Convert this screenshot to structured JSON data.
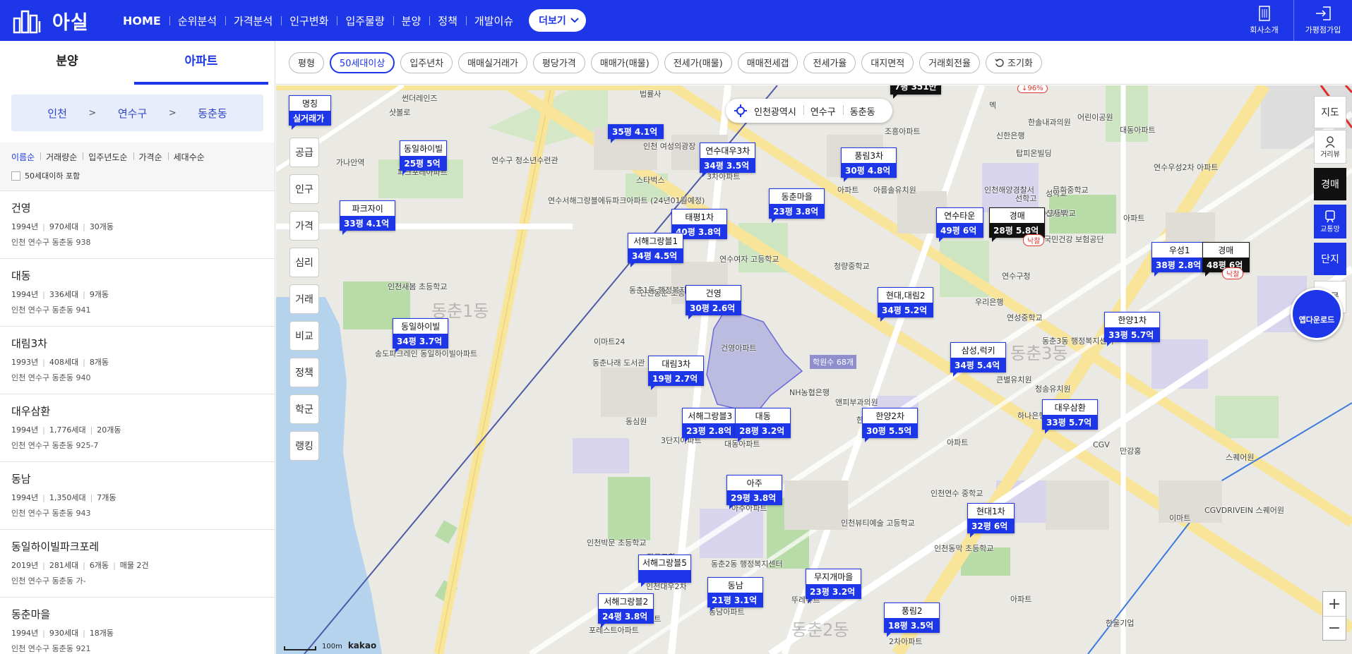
{
  "header": {
    "logo_text": "아실",
    "nav": [
      "HOME",
      "순위분석",
      "가격분석",
      "인구변화",
      "입주물량",
      "분양",
      "정책",
      "개발이슈"
    ],
    "more_label": "더보기",
    "right": [
      {
        "label": "회사소개",
        "icon": "building-icon"
      },
      {
        "label": "가평점가입",
        "icon": "login-icon"
      }
    ]
  },
  "sidebar": {
    "tabs": [
      "분양",
      "아파트"
    ],
    "active_tab": "아파트",
    "breadcrumb": [
      "인천",
      "연수구",
      "동춘동"
    ],
    "sort_options": [
      "이름순",
      "거래량순",
      "입주년도순",
      "가격순",
      "세대수순"
    ],
    "checkbox_label": "50세대이하 포함",
    "items": [
      {
        "name": "건영",
        "year": "1994년",
        "households": "970세대",
        "buildings": "30개동",
        "extra": "",
        "address": "인천 연수구 동춘동 938"
      },
      {
        "name": "대동",
        "year": "1994년",
        "households": "336세대",
        "buildings": "9개동",
        "extra": "",
        "address": "인천 연수구 동춘동 941"
      },
      {
        "name": "대림3차",
        "year": "1993년",
        "households": "408세대",
        "buildings": "8개동",
        "extra": "",
        "address": "인천 연수구 동춘동 940"
      },
      {
        "name": "대우삼환",
        "year": "1994년",
        "households": "1,776세대",
        "buildings": "20개동",
        "extra": "",
        "address": "인천 연수구 동춘동 925-7"
      },
      {
        "name": "동남",
        "year": "1994년",
        "households": "1,350세대",
        "buildings": "7개동",
        "extra": "",
        "address": "인천 연수구 동춘동 943"
      },
      {
        "name": "동일하이빌파크포레",
        "year": "2019년",
        "households": "281세대",
        "buildings": "6개동",
        "extra": "매물 2건",
        "address": "인천 연수구 동춘동 가-"
      },
      {
        "name": "동춘마을",
        "year": "1994년",
        "households": "930세대",
        "buildings": "18개동",
        "extra": "",
        "address": "인천 연수구 동춘동 921"
      }
    ]
  },
  "filters": {
    "chips": [
      "평형",
      "50세대이상",
      "입주년차",
      "매매실거래가",
      "평당가격",
      "매매가(매물)",
      "전세가(매물)",
      "매매전세갭",
      "전세가율",
      "대지면적",
      "거래회전율"
    ],
    "active": "50세대이상",
    "reset_label": "조기화"
  },
  "map": {
    "location_pill": [
      "인천광역시",
      "연수구",
      "동춘동"
    ],
    "left_buttons": [
      "공급",
      "인구",
      "가격",
      "심리",
      "거래",
      "비교",
      "정책",
      "학군",
      "랭킹"
    ],
    "right_buttons": [
      "지도",
      "거리뷰",
      "경매",
      "교통망",
      "단지",
      "매물"
    ],
    "app_download": "앱다운로드",
    "scale": "100m",
    "provider": "kakao",
    "hakwon_label": "학원수 68개",
    "nakchal_label": "낙찰",
    "top_marker_value": "7평 351만",
    "top_marker_change": "↓96%",
    "markers": [
      {
        "name": "명칭",
        "value": "실거래가"
      },
      {
        "name": "동일하이빌",
        "value": "25평 5억"
      },
      {
        "name": "파크자이",
        "value": "33평 4.1억"
      },
      {
        "name": "동일하이빌",
        "value": "34평 3.7억"
      },
      {
        "name": "",
        "value": "35평 4.1억"
      },
      {
        "name": "연수대우3차",
        "value": "34평 3.5억"
      },
      {
        "name": "풍림3차",
        "value": "30평 4.8억"
      },
      {
        "name": "동춘마을",
        "value": "23평 3.8억"
      },
      {
        "name": "태평1차",
        "value": "40평 3.8억"
      },
      {
        "name": "서해그랑블1",
        "value": "34평 4.5억"
      },
      {
        "name": "연수타운",
        "value": "49평 6억"
      },
      {
        "name": "경매",
        "value": "28평 5.8억"
      },
      {
        "name": "우성1",
        "value": "38평 2.8억"
      },
      {
        "name": "경매",
        "value": "48평 6억"
      },
      {
        "name": "건영",
        "value": "30평 2.6억"
      },
      {
        "name": "현대,대림2",
        "value": "34평 5.2억"
      },
      {
        "name": "한양1차",
        "value": "33평 5.7억"
      },
      {
        "name": "대림3차",
        "value": "19평 2.7억"
      },
      {
        "name": "삼성,럭키",
        "value": "34평 5.4억"
      },
      {
        "name": "서해그랑블3",
        "value": "23평 2.8억"
      },
      {
        "name": "대동",
        "value": "28평 3.2억"
      },
      {
        "name": "한양2차",
        "value": "30평 5.5억"
      },
      {
        "name": "대우삼환",
        "value": "33평 5.7억"
      },
      {
        "name": "아주",
        "value": "29평 3.8억"
      },
      {
        "name": "현대1차",
        "value": "32평 6억"
      },
      {
        "name": "서해그랑블5",
        "value": ""
      },
      {
        "name": "동남",
        "value": "21평 3.1억"
      },
      {
        "name": "무지개마을",
        "value": "23평 3.2억"
      },
      {
        "name": "서해그랑블2",
        "value": "24평 3.8억"
      },
      {
        "name": "풍림2",
        "value": "18평 3.5억"
      }
    ],
    "labels": [
      "썬더레인즈",
      "샷볼로",
      "법률사",
      "조흥아파트",
      "신한은행",
      "한솔내과의원",
      "어린이공원",
      "대동아파트",
      "멕",
      "탑피온빌딩",
      "인천 여성의광장",
      "연수구 청소년수련관",
      "스타벅스",
      "가나안역",
      "파크포레아파트",
      "3차아파트",
      "아파트",
      "아름솔유치원",
      "인천해양경찰서",
      "문화중학교",
      "연수고등학교",
      "선학고",
      "성악교",
      "신사부",
      "아파트",
      "연수우성2차 아파트",
      "국민건강 보험공단",
      "연수구청",
      "우리은행",
      "연성중학교",
      "동춘3동 행정복지센터",
      "큰별유치원",
      "청송유치원",
      "하나은행",
      "연수서해그랑블에듀파크아파트 (24년01월예정)",
      "인천새봄 초등학교",
      "송도파크레인 동일하이빌아파트",
      "이마트24",
      "동춘나래 도서관",
      "건영아파트",
      "인천동춘 초등학교",
      "동춘1동 행정복지센터",
      "청량중학교",
      "연수여자 고등학교",
      "NH농협은행",
      "앤피부과의원",
      "한양2차 아파트",
      "동심원",
      "대동아파트",
      "3단지아파트",
      "아주아파트",
      "인천뷰티예술 고등학교",
      "인천연수 중학교",
      "인천동막 초등학교",
      "만강홍",
      "CGV",
      "스퀘어원",
      "CGVDRIVEIN 스퀘어원",
      "이마트",
      "한울기업",
      "동춘2동 행정복지센터",
      "뚜레쥬르",
      "인천박문 초등학교",
      "장로교회",
      "포레스트아파트",
      "2차아파트",
      "동남아파트",
      "아파트",
      "인천대우2차",
      "아파트",
      "아파트"
    ]
  }
}
